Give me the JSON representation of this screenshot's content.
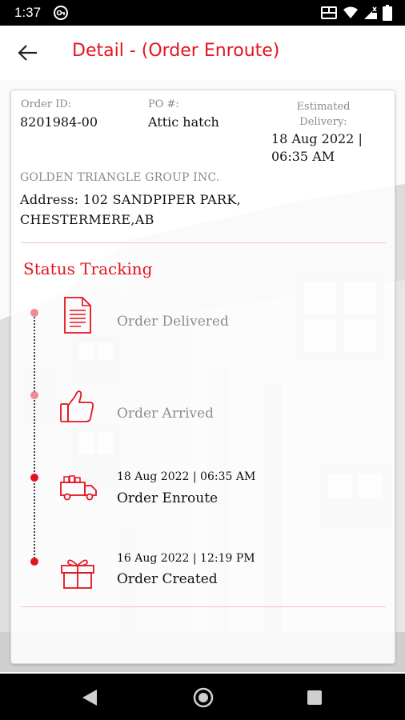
{
  "status_bar": {
    "time": "1:37",
    "icons": [
      "vpn-key-icon",
      "volte-icon",
      "wifi-icon",
      "signal-icon",
      "battery-icon"
    ]
  },
  "header": {
    "back_icon": "arrow-left-icon",
    "title": "Detail - (Order Enroute)",
    "title_color": "#e3141f"
  },
  "order": {
    "id_label": "Order ID:",
    "id_value": "8201984-00",
    "po_label": "PO #:",
    "po_value": "Attic hatch",
    "est_label": "Estimated Delivery:",
    "est_value": "18 Aug 2022 | 06:35 AM",
    "company": "GOLDEN TRIANGLE GROUP INC.",
    "address": "Address: 102 SANDPIPER PARK, CHESTERMERE,AB"
  },
  "tracking": {
    "title": "Status Tracking",
    "steps": [
      {
        "icon": "document-icon",
        "title": "Order Delivered",
        "time": "",
        "state": "pending"
      },
      {
        "icon": "thumbs-up-icon",
        "title": "Order Arrived",
        "time": "",
        "state": "pending"
      },
      {
        "icon": "delivery-truck-icon",
        "title": "Order Enroute",
        "time": "18 Aug 2022 | 06:35 AM",
        "state": "done"
      },
      {
        "icon": "gift-icon",
        "title": "Order Created",
        "time": "16 Aug 2022 | 12:19 PM",
        "state": "done"
      }
    ]
  },
  "colors": {
    "accent": "#e3141f",
    "pending_dot": "#ee8b92",
    "pending_text": "#8d8d8d",
    "divider": "#f0c4c6"
  },
  "nav_bar": {
    "icons": [
      "nav-back-icon",
      "nav-home-icon",
      "nav-recents-icon"
    ]
  }
}
